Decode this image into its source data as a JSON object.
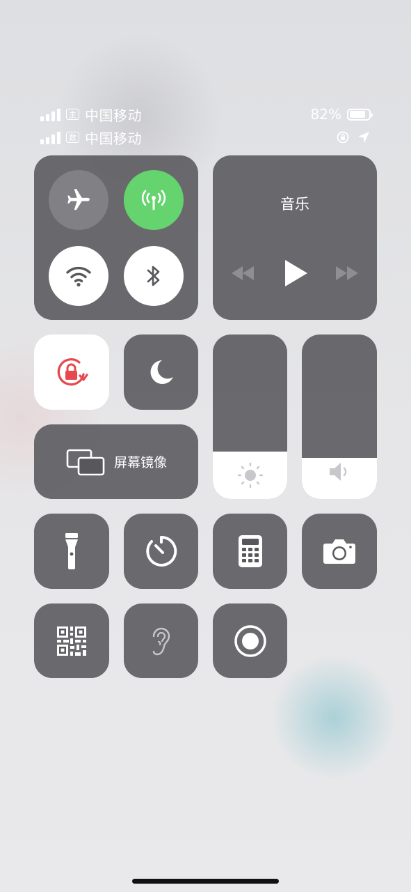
{
  "status": {
    "sim1": {
      "badge": "主",
      "carrier": "中国移动"
    },
    "sim2": {
      "badge": "数",
      "carrier": "中国移动"
    },
    "battery_text": "82%",
    "battery_level": 0.82
  },
  "connectivity": {
    "airplane": {
      "icon": "airplane-icon",
      "active": false
    },
    "cellular": {
      "icon": "cellular-antenna-icon",
      "active": true
    },
    "wifi": {
      "icon": "wifi-icon",
      "active": true
    },
    "bluetooth": {
      "icon": "bluetooth-icon",
      "active": true
    }
  },
  "music": {
    "title": "音乐",
    "controls": [
      "rewind-icon",
      "play-icon",
      "fast-forward-icon"
    ]
  },
  "toggles": {
    "orientation_lock": {
      "icon": "orientation-lock-icon",
      "active": true
    },
    "do_not_disturb": {
      "icon": "moon-icon",
      "active": false
    }
  },
  "screen_mirroring": {
    "label": "屏幕镜像",
    "icon": "screen-mirroring-icon"
  },
  "sliders": {
    "brightness": {
      "icon": "sun-icon",
      "level": 0.29
    },
    "volume": {
      "icon": "speaker-icon",
      "level": 0.25
    }
  },
  "shortcuts": [
    {
      "name": "flashlight",
      "icon": "flashlight-icon"
    },
    {
      "name": "timer",
      "icon": "timer-icon"
    },
    {
      "name": "calculator",
      "icon": "calculator-icon"
    },
    {
      "name": "camera",
      "icon": "camera-icon"
    },
    {
      "name": "qr-scanner",
      "icon": "qr-code-icon"
    },
    {
      "name": "hearing",
      "icon": "ear-icon"
    },
    {
      "name": "screen-recording",
      "icon": "record-icon"
    }
  ],
  "colors": {
    "tile": "#58585c",
    "active_green": "#65d46e",
    "lock_red": "#e5484d",
    "white": "#ffffff"
  }
}
